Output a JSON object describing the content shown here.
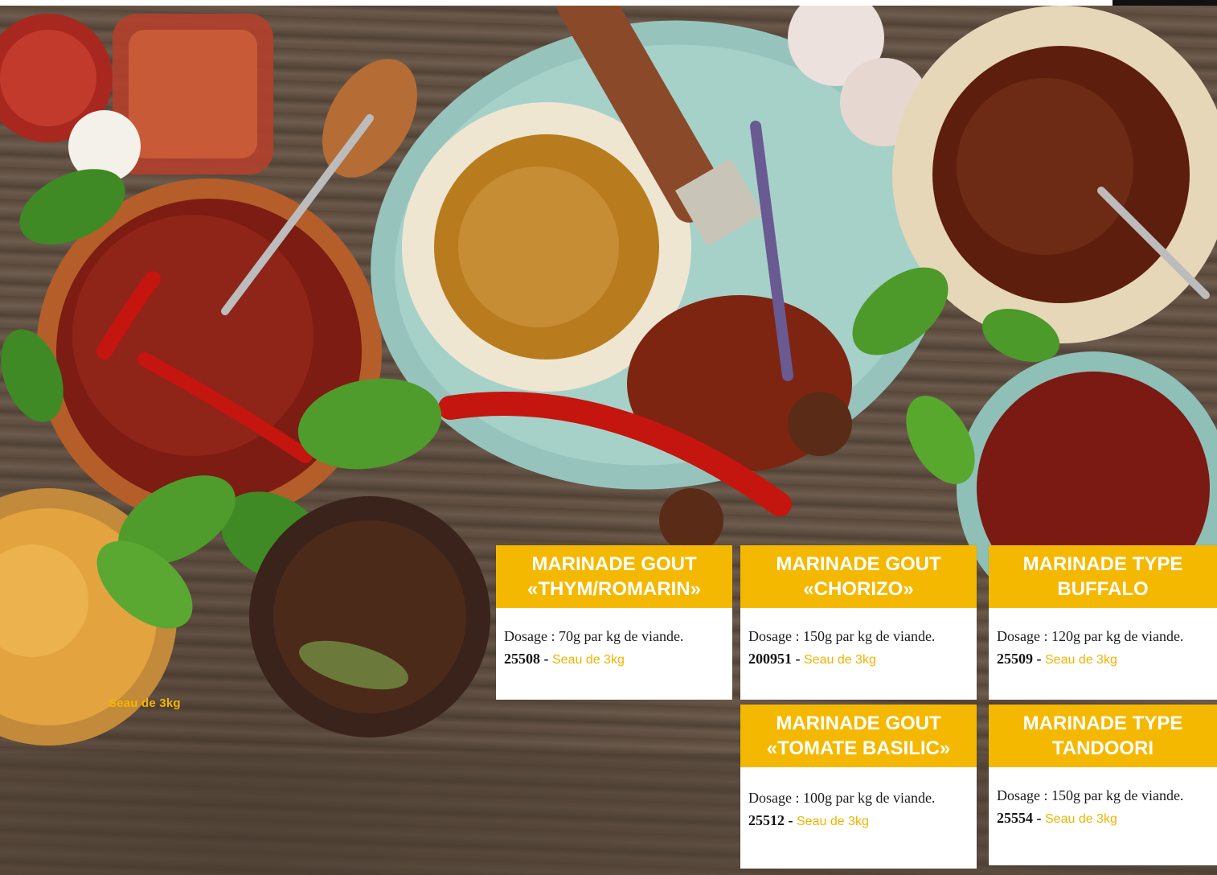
{
  "photo_label": "Seau de 3kg",
  "cards": [
    {
      "title_lines": [
        "MARINADE GOUT",
        "«THYM/ROMARIN»"
      ],
      "dosage": "Dosage : 70g par kg de viande.",
      "code": "25508",
      "separator": " - ",
      "pack": "Seau de 3kg"
    },
    {
      "title_lines": [
        "MARINADE GOUT",
        "«CHORIZO»"
      ],
      "dosage": "Dosage : 150g par kg de viande.",
      "code": "200951",
      "separator": " - ",
      "pack": "Seau de 3kg"
    },
    {
      "title_lines": [
        "MARINADE TYPE",
        "BUFFALO"
      ],
      "dosage": "Dosage : 120g par kg de viande.",
      "code": "25509",
      "separator": " - ",
      "pack": "Seau de 3kg"
    },
    {
      "title_lines": [
        "MARINADE GOUT",
        "«TOMATE BASILIC»"
      ],
      "dosage": "Dosage : 100g par kg de viande.",
      "code": "25512",
      "separator": " - ",
      "pack": "Seau de 3kg"
    },
    {
      "title_lines": [
        "MARINADE TYPE",
        "TANDOORI"
      ],
      "dosage": "Dosage : 150g par kg de viande.",
      "code": "25554",
      "separator": " - ",
      "pack": "Seau de 3kg"
    }
  ],
  "colors": {
    "accent": "#f5b800",
    "pack_text": "#f0b400",
    "card_bg": "#ffffff",
    "wood": "#5a4a3d"
  }
}
